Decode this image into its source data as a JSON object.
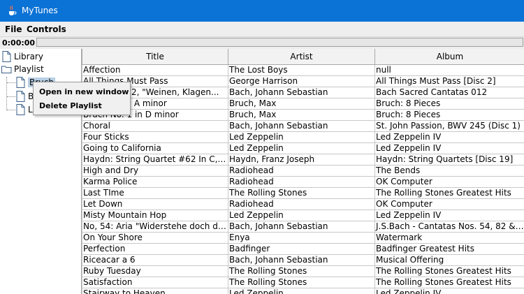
{
  "window": {
    "title": "MyTunes"
  },
  "menubar": {
    "items": [
      "File",
      "Controls"
    ]
  },
  "player": {
    "time": "0:00:00",
    "progress": 0
  },
  "tree": {
    "library": "Library",
    "playlist": "Playlist",
    "children": [
      "Bruch",
      "B",
      "L"
    ]
  },
  "context_menu": {
    "items": [
      "Open in new window",
      "Delete Playlist"
    ]
  },
  "table": {
    "columns": [
      "Title",
      "Artist",
      "Album"
    ],
    "rows": [
      [
        "Affection",
        "The Lost Boys",
        "null"
      ],
      [
        "All Things Must Pass",
        "George Harrison",
        "All Things Must Pass [Disc 2]"
      ],
      [
        "Cantata #12, \"Weinen, Klagen...",
        "Bach, Johann Sebastian",
        "Bach Sacred Cantatas 012"
      ],
      [
        "Concerto in A minor",
        "Bruch, Max",
        "Bruch: 8 Pieces"
      ],
      [
        "Bruch No. 1 in D minor",
        "Bruch, Max",
        "Bruch: 8 Pieces"
      ],
      [
        "Choral",
        "Bach, Johann Sebastian",
        "St. John Passion, BWV 245 (Disc 1)"
      ],
      [
        "Four Sticks",
        "Led Zeppelin",
        "Led Zeppelin IV"
      ],
      [
        "Going to California",
        "Led Zeppelin",
        "Led Zeppelin IV"
      ],
      [
        "Haydn: String Quartet #62 In C, 2. C...",
        "Haydn, Franz Joseph",
        "Haydn: String Quartets [Disc 19]"
      ],
      [
        "High and Dry",
        "Radiohead",
        "The Bends"
      ],
      [
        "Karma Police",
        "Radiohead",
        "OK Computer"
      ],
      [
        "Last TIme",
        "The Rolling Stones",
        "The Rolling Stones Greatest Hits"
      ],
      [
        "Let Down",
        "Radiohead",
        "OK Computer"
      ],
      [
        "Misty Mountain Hop",
        "Led Zeppelin",
        "Led Zeppelin IV"
      ],
      [
        "No, 54: Aria \"Widerstehe doch der S...",
        "Bach, Johann Sebastian",
        "J.S.Bach - Cantatas Nos. 54, 82 & 1..."
      ],
      [
        "On Your Shore",
        "Enya",
        "Watermark"
      ],
      [
        "Perfection",
        "Badfinger",
        "Badfinger Greatest Hits"
      ],
      [
        "Riceacar a 6",
        "Bach, Johann Sebastian",
        "Musical Offering"
      ],
      [
        "Ruby Tuesday",
        "The Rolling Stones",
        "The Rolling Stones Greatest Hits"
      ],
      [
        "Satisfaction",
        "The Rolling Stones",
        "The Rolling Stones Greatest Hits"
      ],
      [
        "Stairway to Heaven",
        "Led Zeppelin",
        "Led Zeppelin IV"
      ]
    ]
  }
}
